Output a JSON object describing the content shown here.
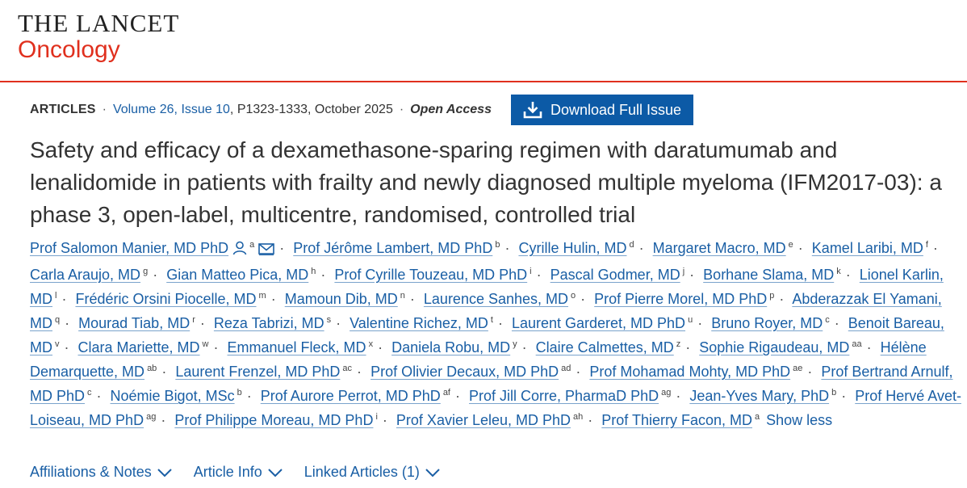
{
  "brand": {
    "name": "THE LANCET",
    "journal": "Oncology"
  },
  "meta": {
    "section": "ARTICLES",
    "volume_link": "Volume 26, Issue 10",
    "pages_date": ", P1323-1333, October 2025",
    "open_access": "Open Access",
    "download_label": "Download Full Issue",
    "separator": "·"
  },
  "article": {
    "title": "Safety and efficacy of a dexamethasone-sparing regimen with daratumumab and lenalidomide in patients with frailty and newly diagnosed multiple myeloma (IFM2017-03): a phase 3, open-label, multicentre, randomised, controlled trial"
  },
  "authors": [
    {
      "name": "Prof Salomon Manier, MD PhD",
      "sup": "a"
    },
    {
      "name": "Prof Jérôme Lambert, MD PhD",
      "sup": "b"
    },
    {
      "name": "Cyrille Hulin, MD",
      "sup": "d"
    },
    {
      "name": "Margaret Macro, MD",
      "sup": "e"
    },
    {
      "name": "Kamel Laribi, MD",
      "sup": "f"
    },
    {
      "name": "Carla Araujo, MD",
      "sup": "g"
    },
    {
      "name": "Gian Matteo Pica, MD",
      "sup": "h"
    },
    {
      "name": "Prof Cyrille Touzeau, MD PhD",
      "sup": "i"
    },
    {
      "name": "Pascal Godmer, MD",
      "sup": "j"
    },
    {
      "name": "Borhane Slama, MD",
      "sup": "k"
    },
    {
      "name": "Lionel Karlin, MD",
      "sup": "l"
    },
    {
      "name": "Frédéric Orsini Piocelle, MD",
      "sup": "m"
    },
    {
      "name": "Mamoun Dib, MD",
      "sup": "n"
    },
    {
      "name": "Laurence Sanhes, MD",
      "sup": "o"
    },
    {
      "name": "Prof Pierre Morel, MD PhD",
      "sup": "p"
    },
    {
      "name": "Abderazzak El Yamani, MD",
      "sup": "q"
    },
    {
      "name": "Mourad Tiab, MD",
      "sup": "r"
    },
    {
      "name": "Reza Tabrizi, MD",
      "sup": "s"
    },
    {
      "name": "Valentine Richez, MD",
      "sup": "t"
    },
    {
      "name": "Laurent Garderet, MD PhD",
      "sup": "u"
    },
    {
      "name": "Bruno Royer, MD",
      "sup": "c"
    },
    {
      "name": "Benoit Bareau, MD",
      "sup": "v"
    },
    {
      "name": "Clara Mariette, MD",
      "sup": "w"
    },
    {
      "name": "Emmanuel Fleck, MD",
      "sup": "x"
    },
    {
      "name": "Daniela Robu, MD",
      "sup": "y"
    },
    {
      "name": "Claire Calmettes, MD",
      "sup": "z"
    },
    {
      "name": "Sophie Rigaudeau, MD",
      "sup": "aa"
    },
    {
      "name": "Hélène Demarquette, MD",
      "sup": "ab"
    },
    {
      "name": "Laurent Frenzel, MD PhD",
      "sup": "ac"
    },
    {
      "name": "Prof Olivier Decaux, MD PhD",
      "sup": "ad"
    },
    {
      "name": "Prof Mohamad Mohty, MD PhD",
      "sup": "ae"
    },
    {
      "name": "Prof Bertrand Arnulf, MD PhD",
      "sup": "c"
    },
    {
      "name": "Noémie Bigot, MSc",
      "sup": "b"
    },
    {
      "name": "Prof Aurore Perrot, MD PhD",
      "sup": "af"
    },
    {
      "name": "Prof Jill Corre, PharmaD PhD",
      "sup": "ag"
    },
    {
      "name": "Jean-Yves Mary, PhD",
      "sup": "b"
    },
    {
      "name": "Prof Hervé Avet-Loiseau, MD PhD",
      "sup": "ag"
    },
    {
      "name": "Prof Philippe Moreau, MD PhD",
      "sup": "i"
    },
    {
      "name": "Prof Xavier Leleu, MD PhD",
      "sup": "ah"
    },
    {
      "name": "Prof Thierry Facon, MD",
      "sup": "a"
    }
  ],
  "show_less": "Show less",
  "tabs": [
    {
      "label": "Affiliations & Notes"
    },
    {
      "label": "Article Info"
    },
    {
      "label": "Linked Articles (1)"
    }
  ],
  "colors": {
    "accent": "#e0301e",
    "link": "#1a5fa5",
    "button": "#0c5aa6"
  },
  "icons": {
    "author_profile": "person-icon",
    "author_email": "envelope-icon",
    "download": "download-icon",
    "expand": "chevron-down-icon"
  }
}
